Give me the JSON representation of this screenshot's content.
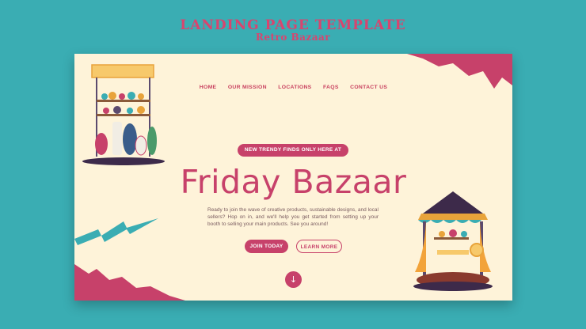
{
  "page": {
    "title": "LANDING PAGE TEMPLATE",
    "subtitle": "Retro Bazaar"
  },
  "nav": {
    "items": [
      "HOME",
      "OUR MISSION",
      "LOCATIONS",
      "FAQS",
      "CONTACT US"
    ]
  },
  "hero": {
    "badge": "NEW TRENDY FINDS ONLY HERE AT",
    "headline": "Friday Bazaar",
    "description": "Ready to join the wave of creative products, sustainable designs, and local sellers? Hop on in, and we'll help you get started from setting up your booth to selling your main products. See you around!",
    "join_label": "JOIN TODAY",
    "learn_label": "LEARN MORE",
    "scroll_icon": "arrow-down-icon"
  },
  "colors": {
    "background": "#3aadb3",
    "card": "#fef3d9",
    "accent": "#c7416a",
    "teal": "#3aadb3"
  }
}
